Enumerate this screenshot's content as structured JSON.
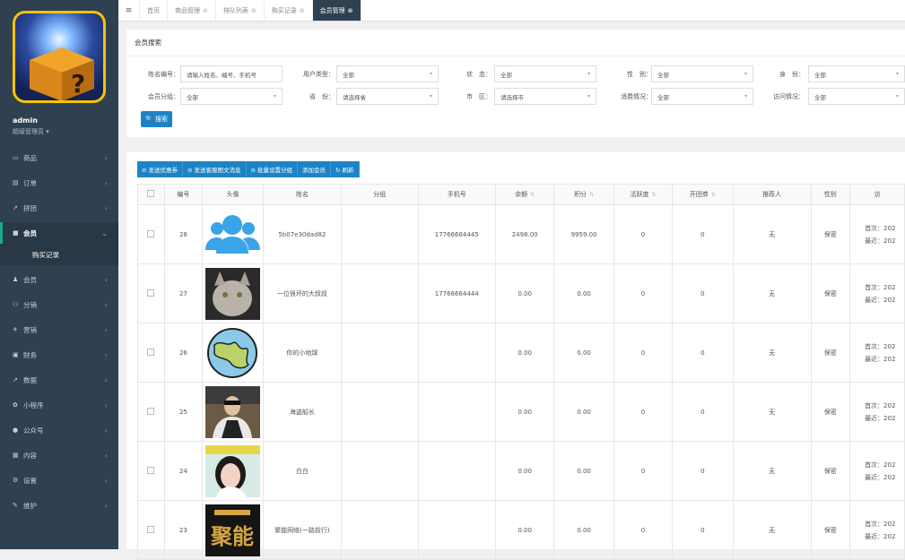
{
  "sidebar": {
    "user": "admin",
    "role": "超级管理员 ▾",
    "items": [
      {
        "label": "商品",
        "icon": "▭"
      },
      {
        "label": "订单",
        "icon": "▤"
      },
      {
        "label": "拼团",
        "icon": "↗"
      },
      {
        "label": "会员",
        "icon": "■",
        "active": true
      },
      {
        "label": "购买记录",
        "sub": true
      },
      {
        "label": "会员",
        "icon": "♟"
      },
      {
        "label": "分销",
        "icon": "⚇"
      },
      {
        "label": "营销",
        "icon": "✈"
      },
      {
        "label": "财务",
        "icon": "▣"
      },
      {
        "label": "数据",
        "icon": "↗"
      },
      {
        "label": "小程序",
        "icon": "✿"
      },
      {
        "label": "公众号",
        "icon": "●"
      },
      {
        "label": "内容",
        "icon": "▦"
      },
      {
        "label": "设置",
        "icon": "⚙"
      },
      {
        "label": "维护",
        "icon": "✎"
      }
    ]
  },
  "topbar": {
    "tabs": [
      {
        "label": "首页"
      },
      {
        "label": "商品管理",
        "x": "⊗"
      },
      {
        "label": "排队列表",
        "x": "⊗"
      },
      {
        "label": "购买记录",
        "x": "⊗"
      },
      {
        "label": "会员管理",
        "x": "⊗",
        "active": true
      }
    ]
  },
  "search": {
    "title": "会员搜索",
    "row1": [
      {
        "label": "姓名编号：",
        "value": "请输入姓名、编号、手机号"
      },
      {
        "label": "用户类型：",
        "value": "全部"
      },
      {
        "label": "状　态：",
        "value": "全部"
      },
      {
        "label": "性　别：",
        "value": "全部"
      },
      {
        "label": "身　份：",
        "value": "全部"
      }
    ],
    "row2": [
      {
        "label": "会员分组：",
        "value": "全部"
      },
      {
        "label": "省　份：",
        "value": "请选择省"
      },
      {
        "label": "市　区：",
        "value": "请选择市"
      },
      {
        "label": "消费情况：",
        "value": "全部"
      },
      {
        "label": "访问情况：",
        "value": "全部"
      }
    ],
    "button": "🔍 搜索"
  },
  "toolbar": [
    "⊖ 发送优惠券",
    "⊖ 发送客服图文消息",
    "⊖ 批量设置分组",
    "添加会员",
    "↻ 刷新"
  ],
  "table": {
    "headers": [
      "",
      "编号",
      "头像",
      "姓名",
      "分组",
      "手机号",
      "余额",
      "积分",
      "活跃度",
      "开团券",
      "推荐人",
      "性别",
      "访"
    ],
    "rows": [
      {
        "id": "28",
        "name": "5b07e30dad82",
        "phone": "17766664445",
        "balance": "2498.00",
        "points": "9959.00",
        "active": "0",
        "coupons": "0",
        "ref": "无",
        "gender": "保密",
        "v1": "首次：202",
        "v2": "最近：202"
      },
      {
        "id": "27",
        "name": "一位很坏的大叔叔",
        "phone": "17766664444",
        "balance": "0.00",
        "points": "0.00",
        "active": "0",
        "coupons": "0",
        "ref": "无",
        "gender": "保密",
        "v1": "首次：202",
        "v2": "最近：202"
      },
      {
        "id": "26",
        "name": "你的小地球",
        "phone": "",
        "balance": "0.00",
        "points": "0.00",
        "active": "0",
        "coupons": "0",
        "ref": "无",
        "gender": "保密",
        "v1": "首次：202",
        "v2": "最近：202"
      },
      {
        "id": "25",
        "name": "海盗船长",
        "phone": "",
        "balance": "0.00",
        "points": "0.00",
        "active": "0",
        "coupons": "0",
        "ref": "无",
        "gender": "保密",
        "v1": "首次：202",
        "v2": "最近：202"
      },
      {
        "id": "24",
        "name": "白白",
        "phone": "",
        "balance": "0.00",
        "points": "0.00",
        "active": "0",
        "coupons": "0",
        "ref": "无",
        "gender": "保密",
        "v1": "首次：202",
        "v2": "最近：202"
      },
      {
        "id": "23",
        "name": "聚能网络(一路前行)",
        "phone": "",
        "balance": "0.00",
        "points": "0.00",
        "active": "0",
        "coupons": "0",
        "ref": "无",
        "gender": "保密",
        "v1": "首次：202",
        "v2": "最近：202"
      }
    ]
  }
}
